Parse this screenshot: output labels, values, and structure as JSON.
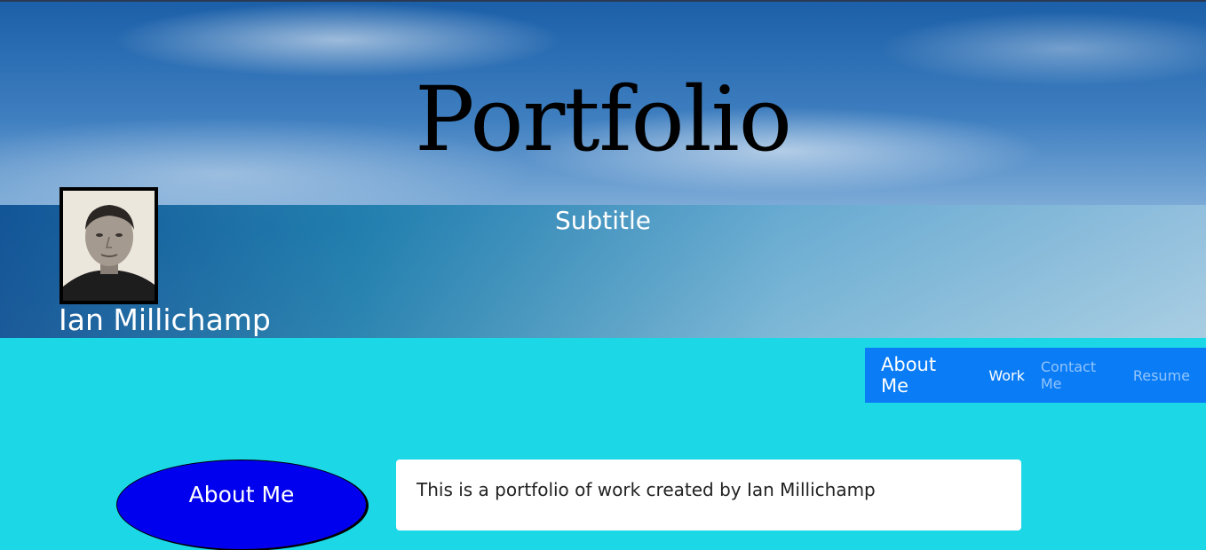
{
  "header": {
    "title": "Portfolio",
    "subtitle": "Subtitle",
    "name": "Ian Millichamp"
  },
  "nav": {
    "brand": "About Me",
    "links": [
      {
        "label": "Work",
        "active": true
      },
      {
        "label": "Contact Me",
        "active": false
      },
      {
        "label": "Resume",
        "active": false
      }
    ]
  },
  "main": {
    "side_button": "About Me",
    "intro": "This is a portfolio of work created by Ian Millichamp"
  },
  "colors": {
    "page_bg": "#1cd8e7",
    "nav_bg": "#0a7cf6",
    "side_button_bg": "#0000ee"
  },
  "icons": {
    "avatar": "profile-photo"
  }
}
